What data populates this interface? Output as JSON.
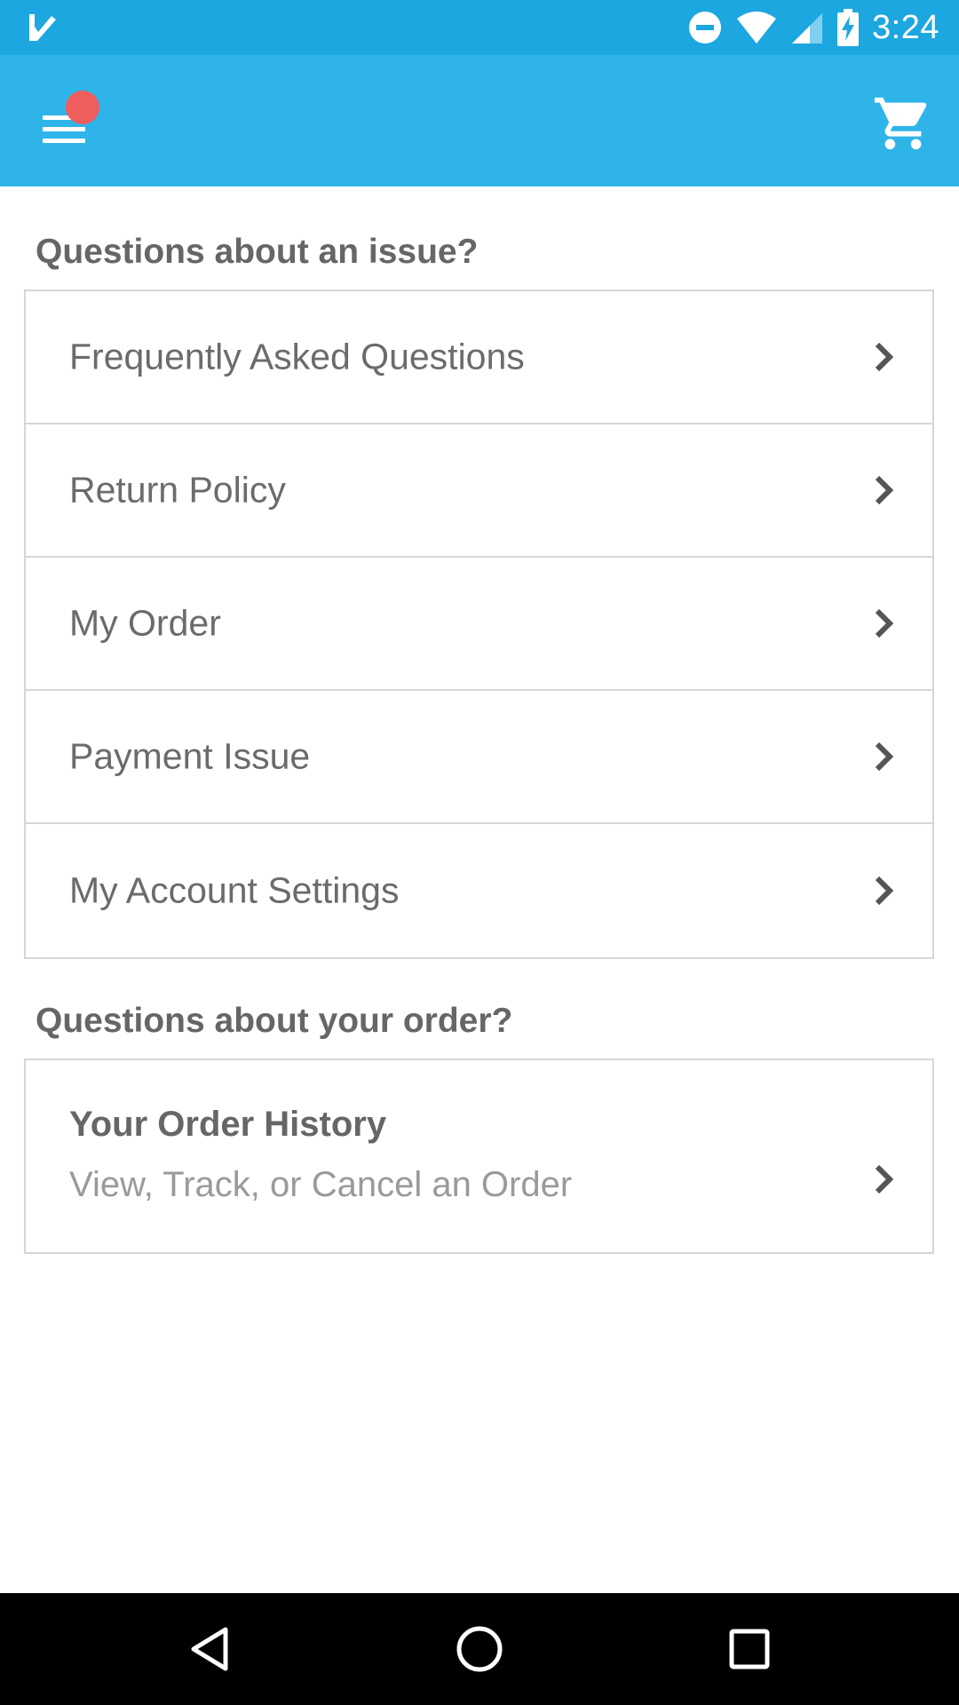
{
  "status_bar": {
    "time": "3:24",
    "icons": [
      "checkmark-notification-icon",
      "do-not-disturb-icon",
      "wifi-icon",
      "signal-icon",
      "battery-charging-icon"
    ]
  },
  "app_bar": {
    "menu_icon": "hamburger-menu-icon",
    "badge_color": "#ef5d5d",
    "cart_icon": "shopping-cart-icon",
    "background": "#2fb4e9"
  },
  "issues_section": {
    "title": "Questions about an issue?",
    "items": [
      {
        "label": "Frequently Asked Questions"
      },
      {
        "label": "Return Policy"
      },
      {
        "label": "My Order"
      },
      {
        "label": "Payment Issue"
      },
      {
        "label": "My Account Settings"
      }
    ]
  },
  "order_section": {
    "title": "Questions about your order?",
    "history": {
      "title": "Your Order History",
      "subtitle": "View, Track, or Cancel an Order"
    }
  },
  "nav_bar": {
    "icons": [
      "back-icon",
      "home-icon",
      "recents-icon"
    ]
  }
}
